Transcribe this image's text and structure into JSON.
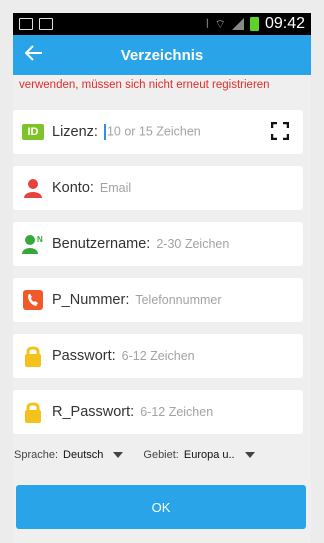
{
  "status": {
    "time": "09:42"
  },
  "header": {
    "back_icon": "arrow-left-icon",
    "title": "Verzeichnis"
  },
  "notice": "verwenden, müssen sich nicht erneut registrieren",
  "form": {
    "license": {
      "label": "Lizenz:",
      "placeholder": "10 or 15 Zeichen",
      "icon": "id-card-icon",
      "accent": "#7ec32a"
    },
    "account": {
      "label": "Konto:",
      "placeholder": "Email",
      "icon": "person-icon",
      "accent": "#e8423d"
    },
    "username": {
      "label": "Benutzername:",
      "placeholder": "2-30 Zeichen",
      "icon": "person-name-icon",
      "accent": "#35a838"
    },
    "phone": {
      "label": "P_Nummer:",
      "placeholder": "Telefonnummer",
      "icon": "phone-icon",
      "accent": "#f05a28"
    },
    "password": {
      "label": "Passwort:",
      "placeholder": "6-12 Zeichen",
      "icon": "lock-icon",
      "accent": "#f4c21a"
    },
    "repeat_password": {
      "label": "R_Passwort:",
      "placeholder": "6-12 Zeichen",
      "icon": "lock-icon",
      "accent": "#f4c21a"
    }
  },
  "language": {
    "label": "Sprache:",
    "value": "Deutsch"
  },
  "region": {
    "label": "Gebiet:",
    "value": "Europa u.."
  },
  "ok_label": "OK",
  "colors": {
    "primary": "#29a4e8",
    "warning": "#e32b2b",
    "background": "#efefef"
  }
}
